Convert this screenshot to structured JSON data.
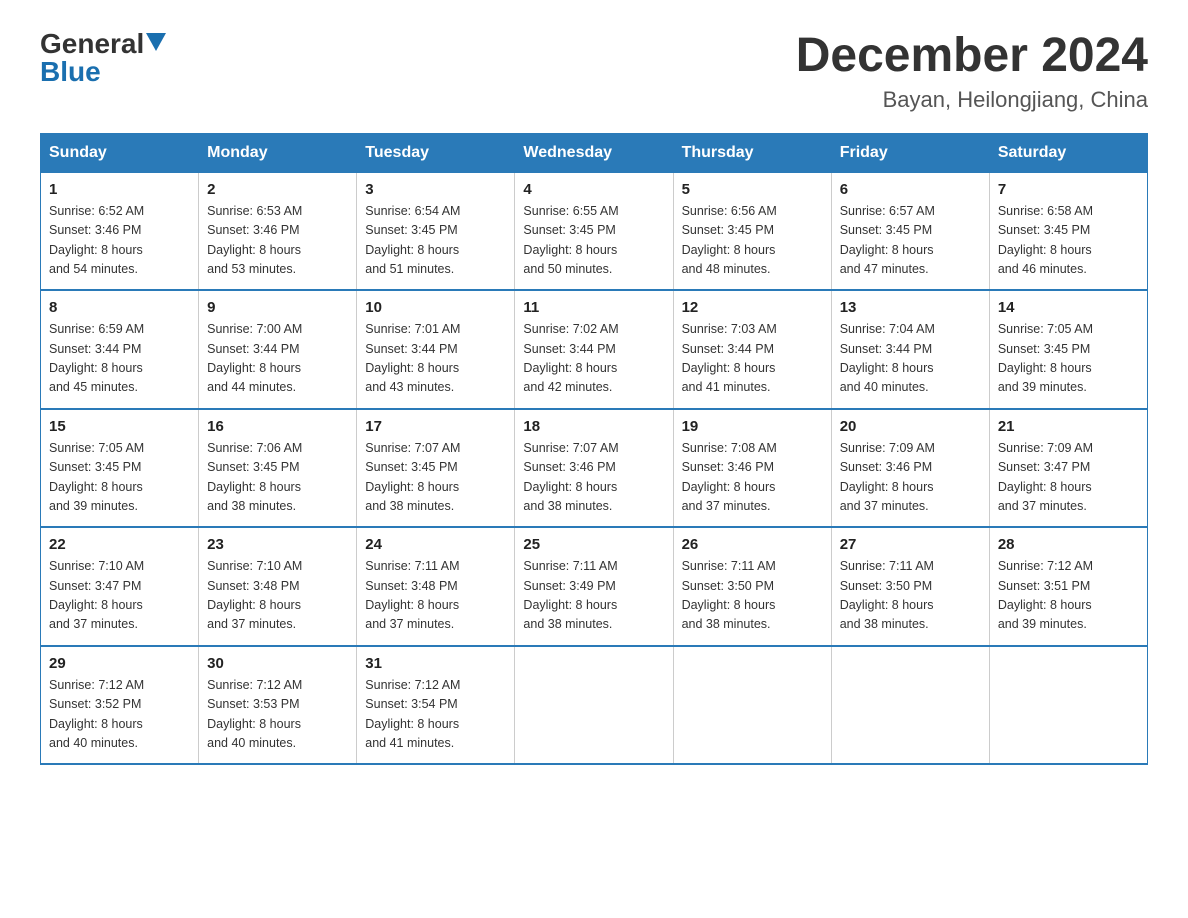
{
  "header": {
    "logo_general": "General",
    "logo_blue": "Blue",
    "title": "December 2024",
    "subtitle": "Bayan, Heilongjiang, China"
  },
  "days_of_week": [
    "Sunday",
    "Monday",
    "Tuesday",
    "Wednesday",
    "Thursday",
    "Friday",
    "Saturday"
  ],
  "weeks": [
    [
      {
        "day": "1",
        "sunrise": "6:52 AM",
        "sunset": "3:46 PM",
        "daylight": "8 hours and 54 minutes."
      },
      {
        "day": "2",
        "sunrise": "6:53 AM",
        "sunset": "3:46 PM",
        "daylight": "8 hours and 53 minutes."
      },
      {
        "day": "3",
        "sunrise": "6:54 AM",
        "sunset": "3:45 PM",
        "daylight": "8 hours and 51 minutes."
      },
      {
        "day": "4",
        "sunrise": "6:55 AM",
        "sunset": "3:45 PM",
        "daylight": "8 hours and 50 minutes."
      },
      {
        "day": "5",
        "sunrise": "6:56 AM",
        "sunset": "3:45 PM",
        "daylight": "8 hours and 48 minutes."
      },
      {
        "day": "6",
        "sunrise": "6:57 AM",
        "sunset": "3:45 PM",
        "daylight": "8 hours and 47 minutes."
      },
      {
        "day": "7",
        "sunrise": "6:58 AM",
        "sunset": "3:45 PM",
        "daylight": "8 hours and 46 minutes."
      }
    ],
    [
      {
        "day": "8",
        "sunrise": "6:59 AM",
        "sunset": "3:44 PM",
        "daylight": "8 hours and 45 minutes."
      },
      {
        "day": "9",
        "sunrise": "7:00 AM",
        "sunset": "3:44 PM",
        "daylight": "8 hours and 44 minutes."
      },
      {
        "day": "10",
        "sunrise": "7:01 AM",
        "sunset": "3:44 PM",
        "daylight": "8 hours and 43 minutes."
      },
      {
        "day": "11",
        "sunrise": "7:02 AM",
        "sunset": "3:44 PM",
        "daylight": "8 hours and 42 minutes."
      },
      {
        "day": "12",
        "sunrise": "7:03 AM",
        "sunset": "3:44 PM",
        "daylight": "8 hours and 41 minutes."
      },
      {
        "day": "13",
        "sunrise": "7:04 AM",
        "sunset": "3:44 PM",
        "daylight": "8 hours and 40 minutes."
      },
      {
        "day": "14",
        "sunrise": "7:05 AM",
        "sunset": "3:45 PM",
        "daylight": "8 hours and 39 minutes."
      }
    ],
    [
      {
        "day": "15",
        "sunrise": "7:05 AM",
        "sunset": "3:45 PM",
        "daylight": "8 hours and 39 minutes."
      },
      {
        "day": "16",
        "sunrise": "7:06 AM",
        "sunset": "3:45 PM",
        "daylight": "8 hours and 38 minutes."
      },
      {
        "day": "17",
        "sunrise": "7:07 AM",
        "sunset": "3:45 PM",
        "daylight": "8 hours and 38 minutes."
      },
      {
        "day": "18",
        "sunrise": "7:07 AM",
        "sunset": "3:46 PM",
        "daylight": "8 hours and 38 minutes."
      },
      {
        "day": "19",
        "sunrise": "7:08 AM",
        "sunset": "3:46 PM",
        "daylight": "8 hours and 37 minutes."
      },
      {
        "day": "20",
        "sunrise": "7:09 AM",
        "sunset": "3:46 PM",
        "daylight": "8 hours and 37 minutes."
      },
      {
        "day": "21",
        "sunrise": "7:09 AM",
        "sunset": "3:47 PM",
        "daylight": "8 hours and 37 minutes."
      }
    ],
    [
      {
        "day": "22",
        "sunrise": "7:10 AM",
        "sunset": "3:47 PM",
        "daylight": "8 hours and 37 minutes."
      },
      {
        "day": "23",
        "sunrise": "7:10 AM",
        "sunset": "3:48 PM",
        "daylight": "8 hours and 37 minutes."
      },
      {
        "day": "24",
        "sunrise": "7:11 AM",
        "sunset": "3:48 PM",
        "daylight": "8 hours and 37 minutes."
      },
      {
        "day": "25",
        "sunrise": "7:11 AM",
        "sunset": "3:49 PM",
        "daylight": "8 hours and 38 minutes."
      },
      {
        "day": "26",
        "sunrise": "7:11 AM",
        "sunset": "3:50 PM",
        "daylight": "8 hours and 38 minutes."
      },
      {
        "day": "27",
        "sunrise": "7:11 AM",
        "sunset": "3:50 PM",
        "daylight": "8 hours and 38 minutes."
      },
      {
        "day": "28",
        "sunrise": "7:12 AM",
        "sunset": "3:51 PM",
        "daylight": "8 hours and 39 minutes."
      }
    ],
    [
      {
        "day": "29",
        "sunrise": "7:12 AM",
        "sunset": "3:52 PM",
        "daylight": "8 hours and 40 minutes."
      },
      {
        "day": "30",
        "sunrise": "7:12 AM",
        "sunset": "3:53 PM",
        "daylight": "8 hours and 40 minutes."
      },
      {
        "day": "31",
        "sunrise": "7:12 AM",
        "sunset": "3:54 PM",
        "daylight": "8 hours and 41 minutes."
      },
      null,
      null,
      null,
      null
    ]
  ],
  "labels": {
    "sunrise": "Sunrise:",
    "sunset": "Sunset:",
    "daylight": "Daylight:"
  }
}
